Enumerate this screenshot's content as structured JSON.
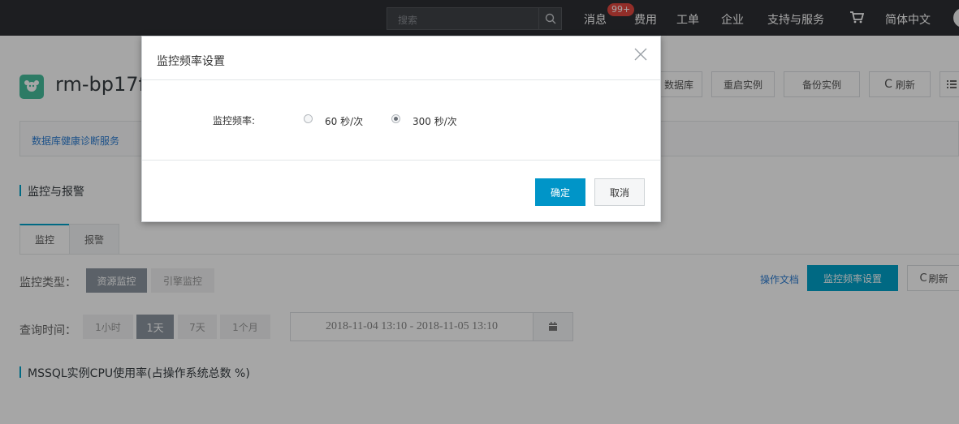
{
  "topbar": {
    "search_placeholder": "搜索",
    "messages": "消息",
    "badge": "99+",
    "billing": "费用",
    "ticket": "工单",
    "enterprise": "企业",
    "support": "支持与服务",
    "language": "简体中文"
  },
  "instance": {
    "title": "rm-bp17f",
    "btn_database": "数据库",
    "btn_restart": "重启实例",
    "btn_backup": "备份实例",
    "btn_refresh": "刷新"
  },
  "diag_link": "数据库健康诊断服务",
  "section_monitor": "监控与报警",
  "tabs": [
    "监控",
    "报警"
  ],
  "monitor_type": {
    "label": "监控类型：",
    "options": [
      "资源监控",
      "引擎监控"
    ],
    "doc_link": "操作文档",
    "freq_btn": "监控频率设置",
    "refresh": "刷新"
  },
  "query_time": {
    "label": "查询时间：",
    "options": [
      "1小时",
      "1天",
      "7天",
      "1个月"
    ],
    "range": "2018-11-04 13:10   -   2018-11-05 13:10"
  },
  "chart_title": "MSSQL实例CPU使用率(占操作系统总数 %)",
  "modal": {
    "title": "监控频率设置",
    "freq_label": "监控频率:",
    "option_60": "60 秒/次",
    "option_300": "300 秒/次",
    "selected": "300 秒/次",
    "ok": "确定",
    "cancel": "取消"
  },
  "colors": {
    "accent": "#00a2ca",
    "topbar": "#2d2f33",
    "badge": "#e0473f",
    "link": "#2f7ed3"
  }
}
